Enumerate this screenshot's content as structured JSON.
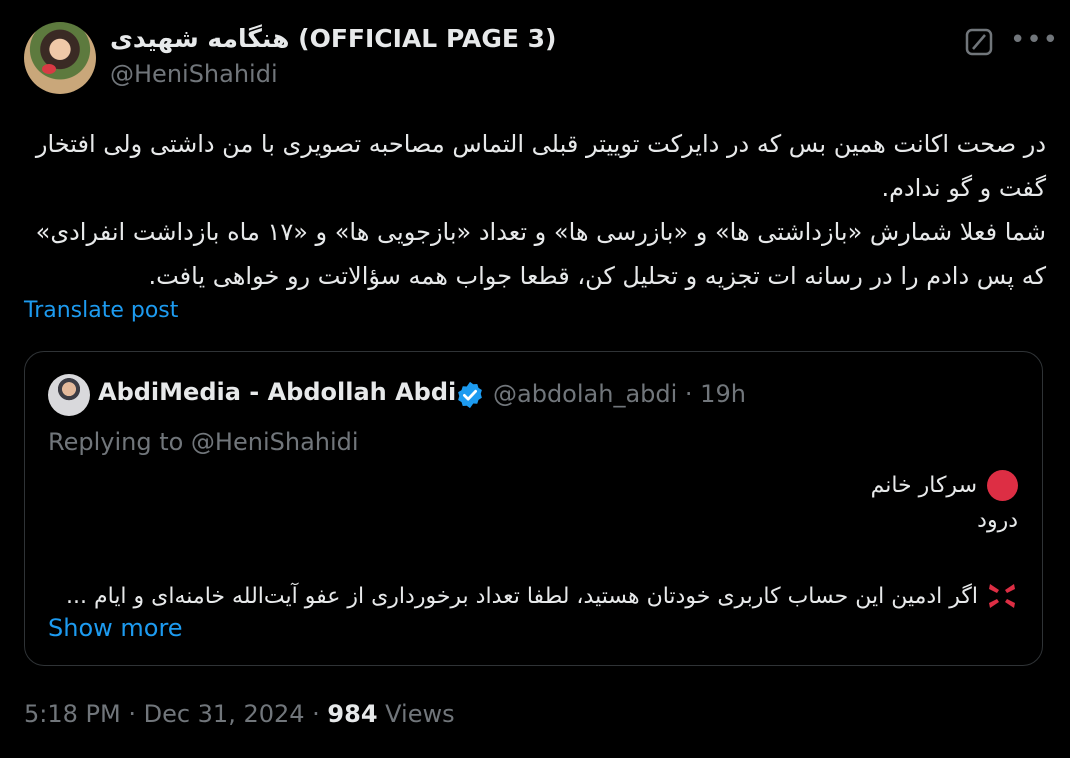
{
  "post": {
    "author_name": "هنگامه شهیدی (OFFICIAL PAGE 3)",
    "author_handle": "@HeniShahidi",
    "body_lines": [
      "در صحت اکانت همین بس که در دایرکت توییتر قبلی التماس مصاحبه تصویری با من داشتی ولی افتخار",
      "گفت و گو ندادم.",
      "شما فعلا شمارش «بازداشتی ها» و «بازرسی ها» و تعداد «بازجویی ها» و «۱۷ ماه بازداشت انفرادی»",
      "که پس دادم را در رسانه ات تجزیه و تحلیل کن، قطعا جواب همه سؤالاتت رو خواهی یافت."
    ],
    "translate_label": "Translate post",
    "timestamp": "5:18 PM · Dec 31, 2024 · ",
    "views_count": "984",
    "views_label": " Views"
  },
  "quote": {
    "author_name": "AbdiMedia - Abdollah Abdi",
    "author_handle_time": "@abdolah_abdi · 19h",
    "replying_to": "Replying to @HeniShahidi",
    "line1": "سرکار خانم",
    "line2": "درود",
    "line3": "اگر ادمین این حساب کاربری خودتان هستید، لطفا تعداد برخورداری از عفو آیت‌الله خامنه‌ای و ایام ...",
    "show_more_label": "Show more"
  },
  "icons": {
    "grok": "grok-icon",
    "more": "more-icon",
    "verified": "verified-badge-icon",
    "red_circle": "red-circle-icon",
    "anger": "anger-symbol-icon"
  },
  "colors": {
    "background": "#000000",
    "text": "#e7e9ea",
    "secondary": "#71767b",
    "link": "#1d9bf0",
    "border": "#2f3336",
    "verified": "#1d9bf0"
  }
}
